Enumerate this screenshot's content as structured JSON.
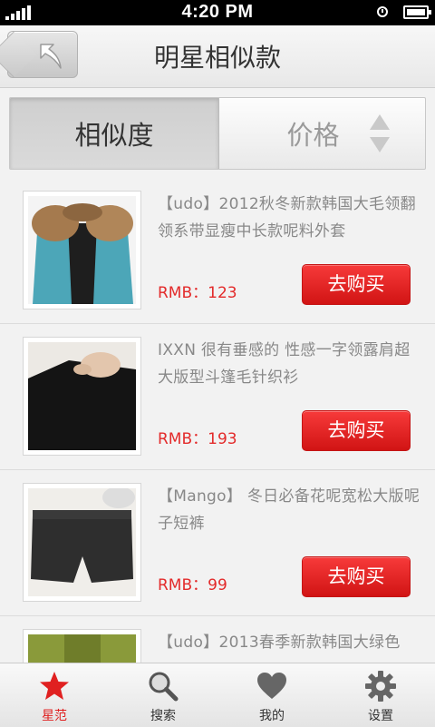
{
  "status_bar": {
    "time": "4:20 PM"
  },
  "header": {
    "title": "明星相似款",
    "back_icon": "back-arrow-icon"
  },
  "sort_tabs": [
    {
      "label": "相似度",
      "active": true
    },
    {
      "label": "价格",
      "active": false,
      "icon": "sort-arrows-icon"
    }
  ],
  "products": [
    {
      "title": "【udo】2012秋冬新款韩国大毛领翻领系带显瘦中长款呢料外套",
      "price": "RMB：123",
      "buy_label": "去购买"
    },
    {
      "title": "IXXN 很有垂感的 性感一字领露肩超大版型斗篷毛针织衫",
      "price": "RMB：193",
      "buy_label": "去购买"
    },
    {
      "title": "【Mango】 冬日必备花呢宽松大版呢子短裤",
      "price": "RMB：99",
      "buy_label": "去购买"
    },
    {
      "title": "【udo】2013春季新款韩国大绿色",
      "price": "",
      "buy_label": ""
    }
  ],
  "tab_bar": [
    {
      "label": "星范",
      "icon": "star-icon",
      "active": true
    },
    {
      "label": "搜索",
      "icon": "magnifier-icon",
      "active": false
    },
    {
      "label": "我的",
      "icon": "heart-icon",
      "active": false
    },
    {
      "label": "设置",
      "icon": "gear-icon",
      "active": false
    }
  ],
  "colors": {
    "accent": "#e02020",
    "price": "#e32b2b",
    "button": "#e32222"
  }
}
